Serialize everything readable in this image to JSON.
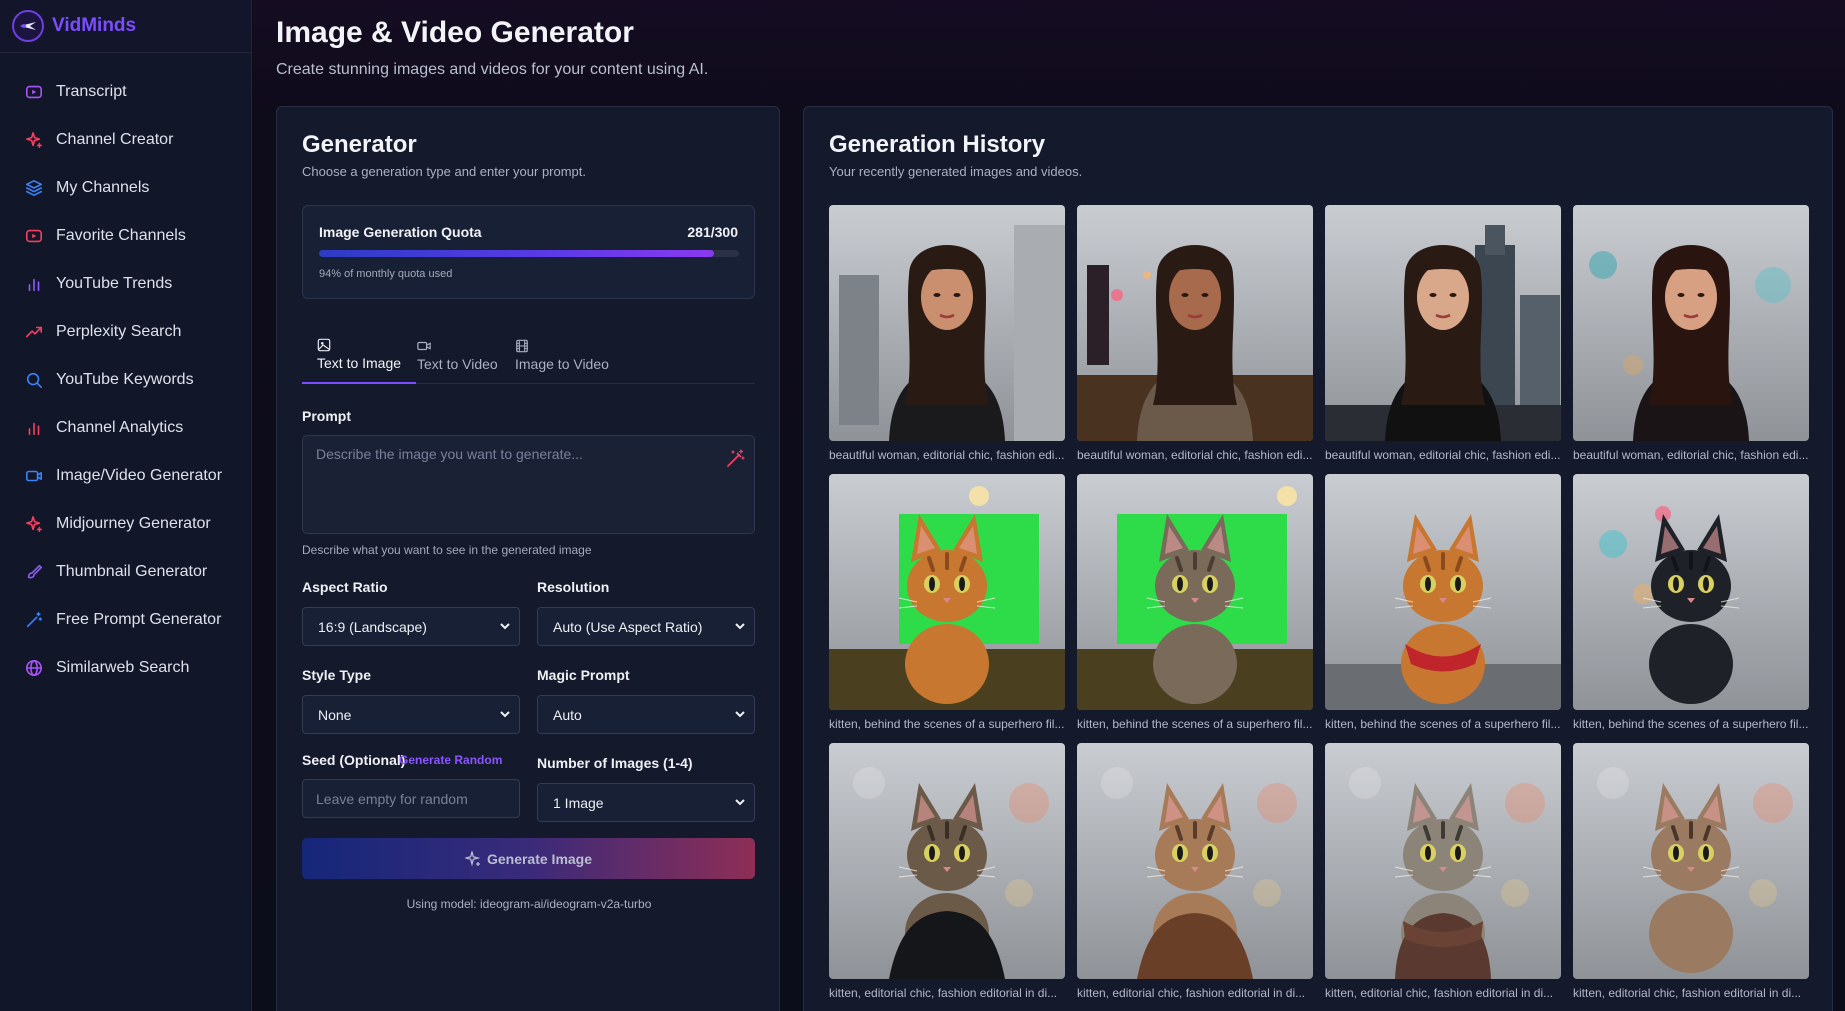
{
  "brand": {
    "name": "VidMinds"
  },
  "sidebar": {
    "items": [
      {
        "label": "Transcript",
        "icon": "play-square-icon",
        "color": "#a855f7"
      },
      {
        "label": "Channel Creator",
        "icon": "sparkle-icon",
        "color": "#f43f5e"
      },
      {
        "label": "My Channels",
        "icon": "layers-icon",
        "color": "#3b82f6"
      },
      {
        "label": "Favorite Channels",
        "icon": "play-square-icon",
        "color": "#f43f5e"
      },
      {
        "label": "YouTube Trends",
        "icon": "bar-chart-icon",
        "color": "#8b5cf6"
      },
      {
        "label": "Perplexity Search",
        "icon": "trending-up-icon",
        "color": "#f43f5e"
      },
      {
        "label": "YouTube Keywords",
        "icon": "search-icon",
        "color": "#3b82f6"
      },
      {
        "label": "Channel Analytics",
        "icon": "bar-chart-icon",
        "color": "#f43f5e"
      },
      {
        "label": "Image/Video Generator",
        "icon": "video-camera-icon",
        "color": "#3b82f6"
      },
      {
        "label": "Midjourney Generator",
        "icon": "sparkle-icon",
        "color": "#f43f5e"
      },
      {
        "label": "Thumbnail Generator",
        "icon": "brush-icon",
        "color": "#8b5cf6"
      },
      {
        "label": "Free Prompt Generator",
        "icon": "wand-icon",
        "color": "#3b82f6"
      },
      {
        "label": "Similarweb Search",
        "icon": "globe-icon",
        "color": "#a855f7"
      }
    ]
  },
  "header": {
    "title": "Image & Video Generator",
    "subtitle": "Create stunning images and videos for your content using AI."
  },
  "generator": {
    "title": "Generator",
    "subtitle": "Choose a generation type and enter your prompt.",
    "quota": {
      "label": "Image Generation Quota",
      "count": "281/300",
      "used_fraction": 0.94,
      "note": "94% of monthly quota used"
    },
    "tabs": [
      {
        "label": "Text to Image",
        "icon": "image-icon",
        "active": true
      },
      {
        "label": "Text to Video",
        "icon": "video-camera-icon",
        "active": false
      },
      {
        "label": "Image to Video",
        "icon": "film-icon",
        "active": false
      }
    ],
    "prompt": {
      "label": "Prompt",
      "placeholder": "Describe the image you want to generate...",
      "helper": "Describe what you want to see in the generated image"
    },
    "aspect_ratio": {
      "label": "Aspect Ratio",
      "value": "16:9 (Landscape)"
    },
    "resolution": {
      "label": "Resolution",
      "value": "Auto (Use Aspect Ratio)"
    },
    "style_type": {
      "label": "Style Type",
      "value": "None"
    },
    "magic_prompt": {
      "label": "Magic Prompt",
      "value": "Auto"
    },
    "seed": {
      "label": "Seed (Optional)",
      "generate_random": "Generate Random",
      "placeholder": "Leave empty for random"
    },
    "num_images": {
      "label": "Number of Images (1-4)",
      "value": "1 Image"
    },
    "button": "Generate Image",
    "model_note": "Using model: ideogram-ai/ideogram-v2a-turbo"
  },
  "history": {
    "title": "Generation History",
    "subtitle": "Your recently generated images and videos.",
    "items": [
      {
        "caption": "beautiful woman, editorial chic, fashion edi...",
        "scene": "woman-city-day"
      },
      {
        "caption": "beautiful woman, editorial chic, fashion edi...",
        "scene": "woman-city-night"
      },
      {
        "caption": "beautiful woman, editorial chic, fashion edi...",
        "scene": "woman-skyline"
      },
      {
        "caption": "beautiful woman, editorial chic, fashion edi...",
        "scene": "woman-neon"
      },
      {
        "caption": "kitten, behind the scenes of a superhero fil...",
        "scene": "kitten-greenscreen"
      },
      {
        "caption": "kitten, behind the scenes of a superhero fil...",
        "scene": "kitten-greenscreen-2"
      },
      {
        "caption": "kitten, behind the scenes of a superhero fil...",
        "scene": "kitten-cape"
      },
      {
        "caption": "kitten, behind the scenes of a superhero fil...",
        "scene": "kitten-dark-city"
      },
      {
        "caption": "kitten, editorial chic, fashion editorial in di...",
        "scene": "kitten-jacket"
      },
      {
        "caption": "kitten, editorial chic, fashion editorial in di...",
        "scene": "kitten-coat"
      },
      {
        "caption": "kitten, editorial chic, fashion editorial in di...",
        "scene": "kitten-scarf"
      },
      {
        "caption": "kitten, editorial chic, fashion editorial in di...",
        "scene": "kitten-street"
      }
    ]
  }
}
